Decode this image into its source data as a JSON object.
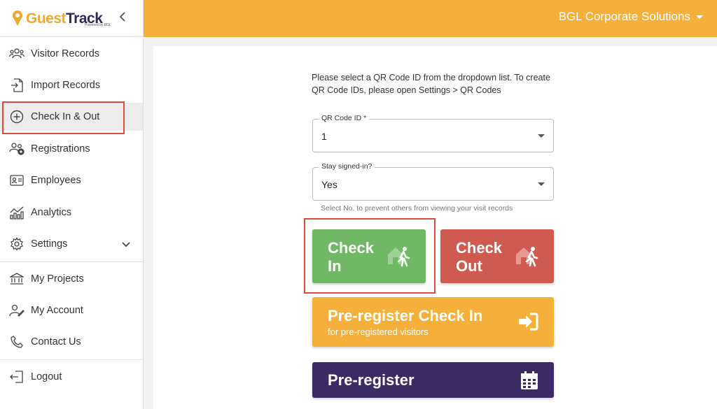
{
  "brand": {
    "name_part1": "Guest",
    "name_part2": "Track",
    "powered": "Powered by BGL"
  },
  "header": {
    "org_name": "BGL Corporate Solutions"
  },
  "sidebar": {
    "items": [
      {
        "label": "Visitor Records",
        "icon": "users-icon"
      },
      {
        "label": "Import Records",
        "icon": "import-icon"
      },
      {
        "label": "Check In & Out",
        "icon": "plus-circle-icon",
        "active": true
      },
      {
        "label": "Registrations",
        "icon": "user-add-icon"
      },
      {
        "label": "Employees",
        "icon": "id-card-icon"
      },
      {
        "label": "Analytics",
        "icon": "analytics-icon"
      },
      {
        "label": "Settings",
        "icon": "gear-icon"
      },
      {
        "label": "My Projects",
        "icon": "bank-icon"
      },
      {
        "label": "My Account",
        "icon": "user-edit-icon"
      },
      {
        "label": "Contact Us",
        "icon": "phone-icon"
      },
      {
        "label": "Logout",
        "icon": "logout-icon"
      }
    ]
  },
  "main": {
    "info_text": "Please select a QR Code ID from the dropdown list. To create QR Code IDs, please open Settings > QR Codes",
    "qr_field": {
      "label": "QR Code ID *",
      "value": "1"
    },
    "signin_field": {
      "label": "Stay signed-in?",
      "value": "Yes"
    },
    "helper_text": "Select No, to prevent others from viewing your visit records",
    "check_in_label": "Check In",
    "check_out_label": "Check Out",
    "preregister_checkin_label": "Pre-register Check In",
    "preregister_checkin_sub": "for pre-registered visitors",
    "preregister_label": "Pre-register"
  },
  "colors": {
    "accent": "#f5b03b",
    "check_in": "#71b866",
    "check_out": "#cf5a50",
    "preregister": "#3b2a63",
    "highlight": "#e14b3b"
  }
}
